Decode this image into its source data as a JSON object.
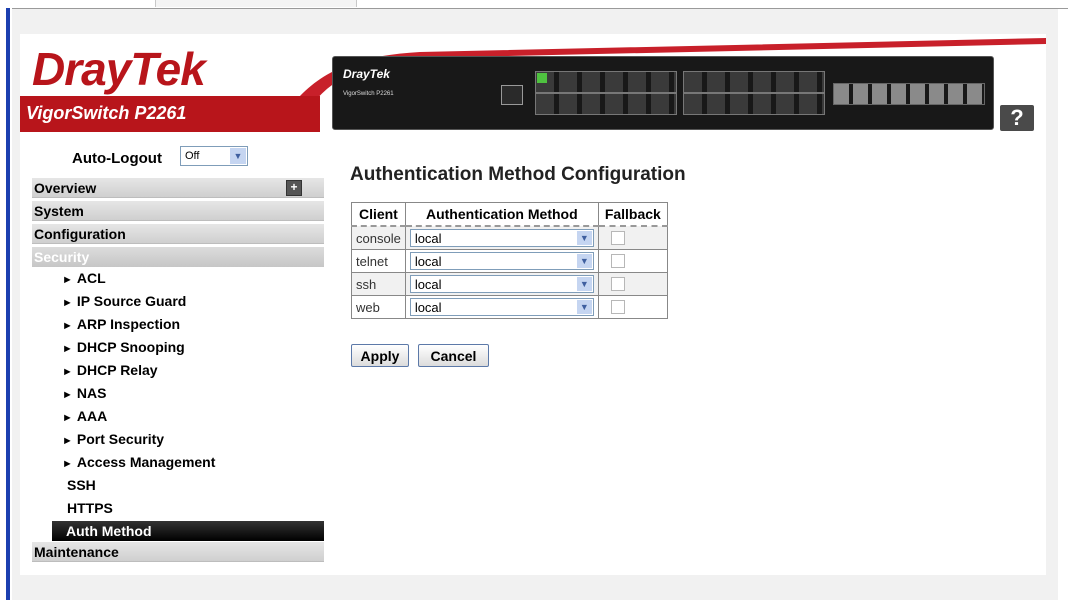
{
  "brand": {
    "logo": "DrayTek",
    "model": "VigorSwitch P2261",
    "device_brand": "DrayTek",
    "device_model": "VigorSwitch P2261",
    "brand_color": "#b8151b"
  },
  "help_label": "?",
  "auto_logout": {
    "label": "Auto-Logout",
    "value": "Off"
  },
  "nav": {
    "overview": "Overview",
    "system": "System",
    "configuration": "Configuration",
    "security": "Security",
    "security_items": [
      "ACL",
      "IP Source Guard",
      "ARP Inspection",
      "DHCP Snooping",
      "DHCP Relay",
      "NAS",
      "AAA",
      "Port Security",
      "Access Management"
    ],
    "ssh": "SSH",
    "https": "HTTPS",
    "auth_method": "Auth Method",
    "maintenance": "Maintenance"
  },
  "main": {
    "title": "Authentication Method Configuration",
    "headers": [
      "Client",
      "Authentication Method",
      "Fallback"
    ],
    "rows": [
      {
        "client": "console",
        "method": "local",
        "fallback": false
      },
      {
        "client": "telnet",
        "method": "local",
        "fallback": false
      },
      {
        "client": "ssh",
        "method": "local",
        "fallback": false
      },
      {
        "client": "web",
        "method": "local",
        "fallback": false
      }
    ],
    "apply": "Apply",
    "cancel": "Cancel"
  }
}
